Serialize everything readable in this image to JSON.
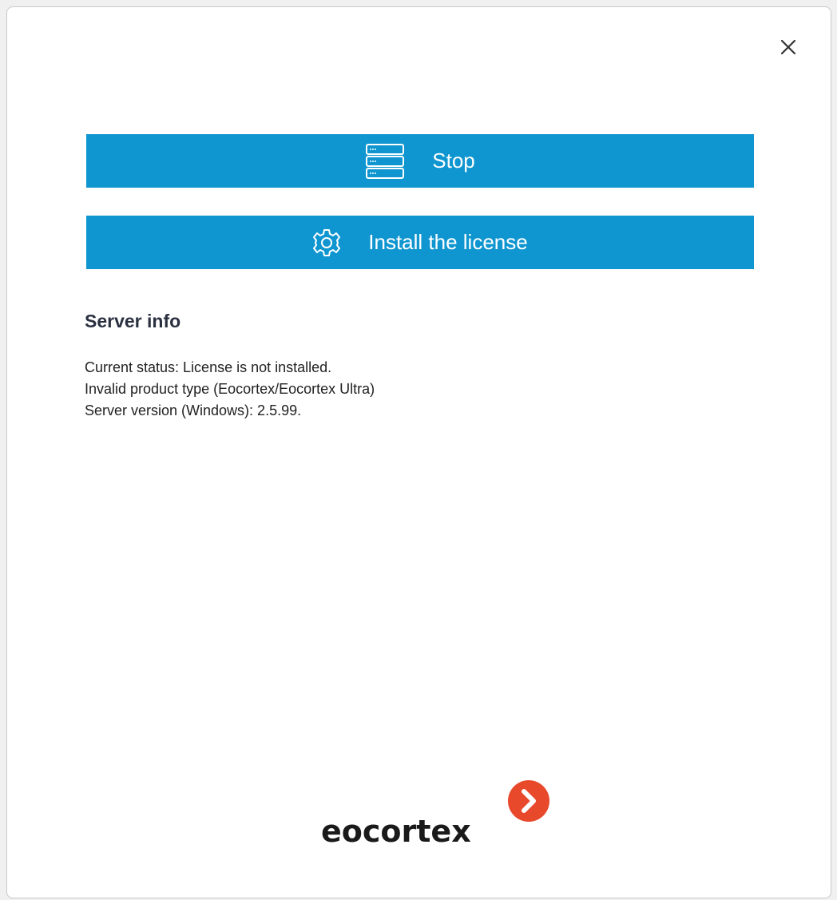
{
  "dialog": {
    "close_icon": "close-icon"
  },
  "buttons": {
    "stop": {
      "label": "Stop",
      "icon": "server-icon"
    },
    "install_license": {
      "label": "Install the license",
      "icon": "gear-icon"
    }
  },
  "server_info": {
    "title": "Server info",
    "lines": [
      "Current status: License is not installed.",
      "Invalid product type (Eocortex/Eocortex Ultra)",
      "Server version (Windows): 2.5.99."
    ]
  },
  "logo": {
    "text": "eocortex",
    "mark_color": "#e8492b"
  },
  "colors": {
    "accent": "#0f96d0",
    "title": "#2a3040"
  }
}
